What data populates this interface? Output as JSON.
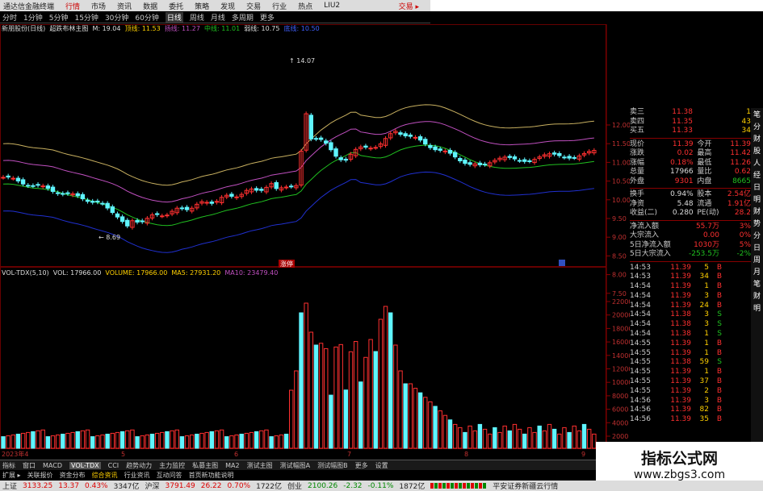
{
  "titlebar": {
    "app": "通达信金融终端",
    "menus": [
      "行情",
      "市场",
      "资讯",
      "数据",
      "委托",
      "策略",
      "发现",
      "交易",
      "行业",
      "热点",
      "LIU2"
    ],
    "right": "交易 ▸"
  },
  "periodbar": {
    "items": [
      "1分钟",
      "5分钟",
      "15分钟",
      "30分钟",
      "60分钟",
      "日线",
      "周线",
      "月线",
      "多周期",
      "更多"
    ],
    "prefix": "分时",
    "selected": "日线"
  },
  "kinfo": {
    "name": "新朋股份(日线)",
    "type": "超跌布林主图",
    "mark": "M: 19.04",
    "l1": "顶线: 11.53",
    "l2": "扬线: 11.27",
    "l3": "中线: 11.01",
    "l4": "弱线: 10.75",
    "l5": "底线: 10.50"
  },
  "labels": {
    "peak": "14.07",
    "low": "8.69",
    "badge": "涨停"
  },
  "volinfo": {
    "ind": "VOL-TDX(5,10)",
    "vol": "VOL: 17966.00",
    "volume": "VOLUME: 17966.00",
    "ma5": "MA5: 27931.20",
    "ma10": "MA10: 23479.40"
  },
  "kaxis": [
    "12.00",
    "11.50",
    "11.00",
    "10.50",
    "10.00",
    "9.50",
    "9.00",
    "8.50",
    "8.00",
    "7.50"
  ],
  "vaxis": [
    "22000",
    "20000",
    "18000",
    "16000",
    "14000",
    "12000",
    "10000",
    "8000",
    "6000",
    "4000",
    "2000"
  ],
  "xlabels": [
    "2023年4",
    "5",
    "6",
    "7",
    "8",
    "9"
  ],
  "quote": {
    "asks": [
      {
        "l": "卖三",
        "p": "11.38",
        "v": "1"
      },
      {
        "l": "卖四",
        "p": "11.35",
        "v": "43"
      },
      {
        "l": "买五",
        "p": "11.33",
        "v": "34"
      }
    ],
    "rows": [
      {
        "a": "现价",
        "b": "11.39",
        "c": "今开",
        "d": "11.39"
      },
      {
        "a": "涨跌",
        "b": "0.02",
        "c": "最高",
        "d": "11.42"
      },
      {
        "a": "涨幅",
        "b": "0.18%",
        "c": "最低",
        "d": "11.26"
      },
      {
        "a": "总量",
        "b": "17966",
        "c": "量比",
        "d": "0.62"
      },
      {
        "a": "外盘",
        "b": "9301",
        "c": "内盘",
        "d": "8665"
      },
      {
        "a": "换手",
        "b": "0.94%",
        "c": "股本",
        "d": "2.54亿"
      },
      {
        "a": "净资",
        "b": "5.48",
        "c": "流通",
        "d": "1.91亿"
      },
      {
        "a": "收益(二)",
        "b": "0.280",
        "c": "PE(动)",
        "d": "28.2"
      }
    ],
    "flows": [
      {
        "a": "净流入额",
        "b": "55.7万",
        "d": "3%"
      },
      {
        "a": "大宗流入",
        "b": "0.00",
        "d": "0%"
      },
      {
        "a": "5日净流入额",
        "b": "1030万",
        "d": "5%"
      },
      {
        "a": "5日大宗流入",
        "b": "-253.5万",
        "d": "-2%"
      }
    ],
    "ticks": [
      {
        "t": "14:53",
        "p": "11.39",
        "v": "5",
        "d": "B"
      },
      {
        "t": "14:53",
        "p": "11.39",
        "v": "34",
        "d": "B"
      },
      {
        "t": "14:54",
        "p": "11.39",
        "v": "1",
        "d": "B"
      },
      {
        "t": "14:54",
        "p": "11.39",
        "v": "3",
        "d": "B"
      },
      {
        "t": "14:54",
        "p": "11.39",
        "v": "24",
        "d": "B"
      },
      {
        "t": "14:54",
        "p": "11.38",
        "v": "3",
        "d": "S"
      },
      {
        "t": "14:54",
        "p": "11.38",
        "v": "3",
        "d": "S"
      },
      {
        "t": "14:54",
        "p": "11.38",
        "v": "1",
        "d": "S"
      },
      {
        "t": "14:55",
        "p": "11.39",
        "v": "1",
        "d": "B"
      },
      {
        "t": "14:55",
        "p": "11.39",
        "v": "1",
        "d": "B"
      },
      {
        "t": "14:55",
        "p": "11.38",
        "v": "59",
        "d": "S"
      },
      {
        "t": "14:55",
        "p": "11.39",
        "v": "1",
        "d": "B"
      },
      {
        "t": "14:55",
        "p": "11.39",
        "v": "37",
        "d": "B"
      },
      {
        "t": "14:55",
        "p": "11.39",
        "v": "2",
        "d": "B"
      },
      {
        "t": "14:56",
        "p": "11.39",
        "v": "3",
        "d": "B"
      },
      {
        "t": "14:56",
        "p": "11.39",
        "v": "82",
        "d": "B"
      },
      {
        "t": "14:56",
        "p": "11.39",
        "v": "35",
        "d": "B"
      }
    ]
  },
  "rightbar": [
    "笔",
    "分",
    "财",
    "股",
    "人",
    "经",
    "日",
    "明",
    "财",
    "势",
    "分",
    "日",
    "周",
    "月",
    "笔",
    "财",
    "明"
  ],
  "tabs": [
    "指标",
    "窗口",
    "MACD",
    "VOL-TDX",
    "CCI",
    "趋势动力",
    "主力监控",
    "私募主图",
    "MA2",
    "测试主图",
    "测试幅图A",
    "测试幅图B",
    "更多",
    "设置"
  ],
  "tabs_selected": "VOL-TDX",
  "subtabs": [
    "扩展 ▸",
    "关联报价",
    "资金分布",
    "综合资讯",
    "行业资讯",
    "互动问答",
    "首页新功能说明"
  ],
  "status": {
    "sh_label": "上证",
    "sh_val": "3133.25",
    "sh_chg": "13.37",
    "sh_pct": "0.43%",
    "sh_amt": "3347亿",
    "sz_label": "沪深",
    "sz_val": "3791.49",
    "sz_chg": "26.22",
    "sz_pct": "0.70%",
    "sz_amt": "1722亿",
    "cy_label": "创业",
    "cy_val": "2100.26",
    "cy_chg": "-2.32",
    "cy_pct": "-0.11%",
    "cy_amt": "1872亿",
    "broker": "平安证券新疆云行情"
  },
  "watermark": {
    "line1": "指标公式网",
    "line2": "www.zbgs3.com"
  },
  "colors": {
    "up": "#ff3030",
    "down": "#5ff5ff",
    "boll_top": "#c8b060",
    "boll_mid": "#c050c0",
    "boll_mid2": "#20c020",
    "boll_bot": "#2030d0"
  }
}
